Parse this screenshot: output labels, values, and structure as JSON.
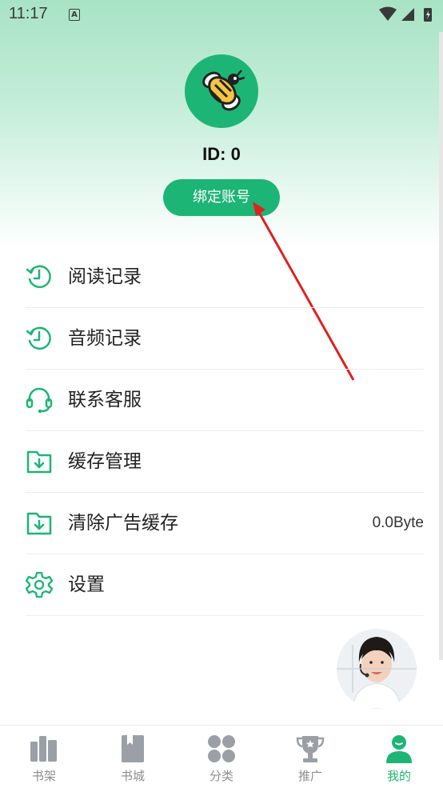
{
  "status_bar": {
    "time": "11:17",
    "a_icon": "A"
  },
  "profile": {
    "id_text": "ID: 0",
    "bind_button": "绑定账号"
  },
  "menu": [
    {
      "label": "阅读记录",
      "icon": "history-icon",
      "value": ""
    },
    {
      "label": "音频记录",
      "icon": "history-icon",
      "value": ""
    },
    {
      "label": "联系客服",
      "icon": "headset-icon",
      "value": ""
    },
    {
      "label": "缓存管理",
      "icon": "folder-download-icon",
      "value": ""
    },
    {
      "label": "清除广告缓存",
      "icon": "folder-download-icon",
      "value": "0.0Byte"
    },
    {
      "label": "设置",
      "icon": "gear-icon",
      "value": ""
    }
  ],
  "tabs": [
    {
      "label": "书架",
      "icon": "bookshelf-icon",
      "active": false
    },
    {
      "label": "书城",
      "icon": "book-icon",
      "active": false
    },
    {
      "label": "分类",
      "icon": "category-icon",
      "active": false
    },
    {
      "label": "推广",
      "icon": "trophy-icon",
      "active": false
    },
    {
      "label": "我的",
      "icon": "user-icon",
      "active": true
    }
  ],
  "colors": {
    "accent": "#1db575",
    "inactive": "#8e8e8e",
    "annotation_arrow": "#e02020"
  }
}
